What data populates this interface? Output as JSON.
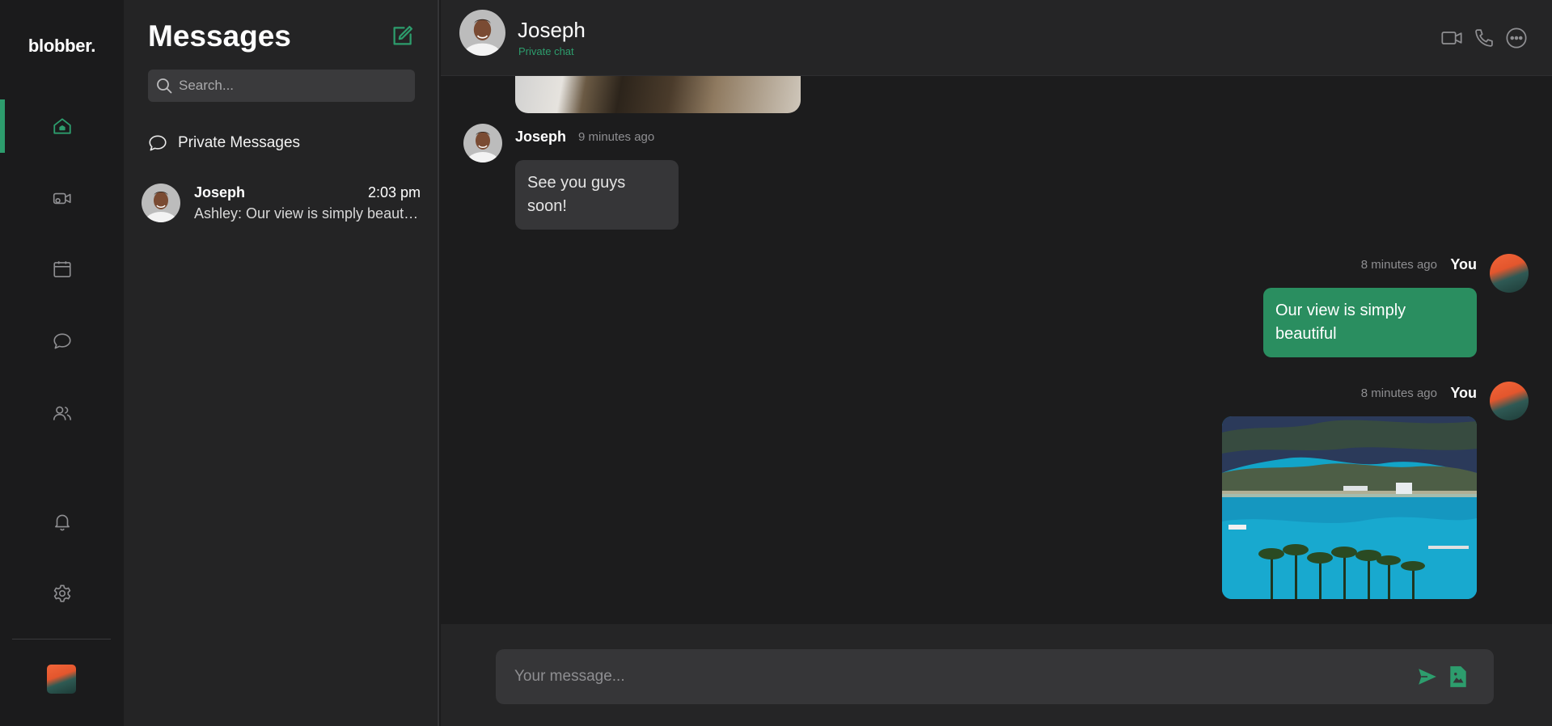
{
  "app": {
    "brand": "blobber."
  },
  "rail": {
    "items": [
      {
        "name": "home",
        "icon": "home-icon",
        "active": true
      },
      {
        "name": "video-rooms",
        "icon": "video-room-icon",
        "active": false
      },
      {
        "name": "calendar",
        "icon": "calendar-icon",
        "active": false
      },
      {
        "name": "messages",
        "icon": "chat-bubble-icon",
        "active": false
      },
      {
        "name": "contacts",
        "icon": "people-icon",
        "active": false
      },
      {
        "name": "notifications",
        "icon": "bell-icon",
        "active": false
      },
      {
        "name": "settings",
        "icon": "gear-icon",
        "active": false
      }
    ],
    "accent": "#2d9d6d"
  },
  "sidebar": {
    "title": "Messages",
    "search_placeholder": "Search...",
    "section_label": "Private Messages",
    "conversations": [
      {
        "name": "Joseph",
        "time": "2:03 pm",
        "preview": "Ashley: Our view is simply beautiful"
      }
    ]
  },
  "chat": {
    "contact_name": "Joseph",
    "contact_subtitle": "Private chat",
    "messages": [
      {
        "sender": "Joseph",
        "time": "9 minutes ago",
        "text": "See you guys soon!"
      },
      {
        "sender": "You",
        "time": "8 minutes ago",
        "text": "Our view is simply beautiful"
      },
      {
        "sender": "You",
        "time": "8 minutes ago",
        "text": "",
        "kind": "image"
      }
    ],
    "composer_placeholder": "Your message...",
    "colors": {
      "outgoing_bubble": "#2a8e60",
      "incoming_bubble": "#363638"
    }
  }
}
